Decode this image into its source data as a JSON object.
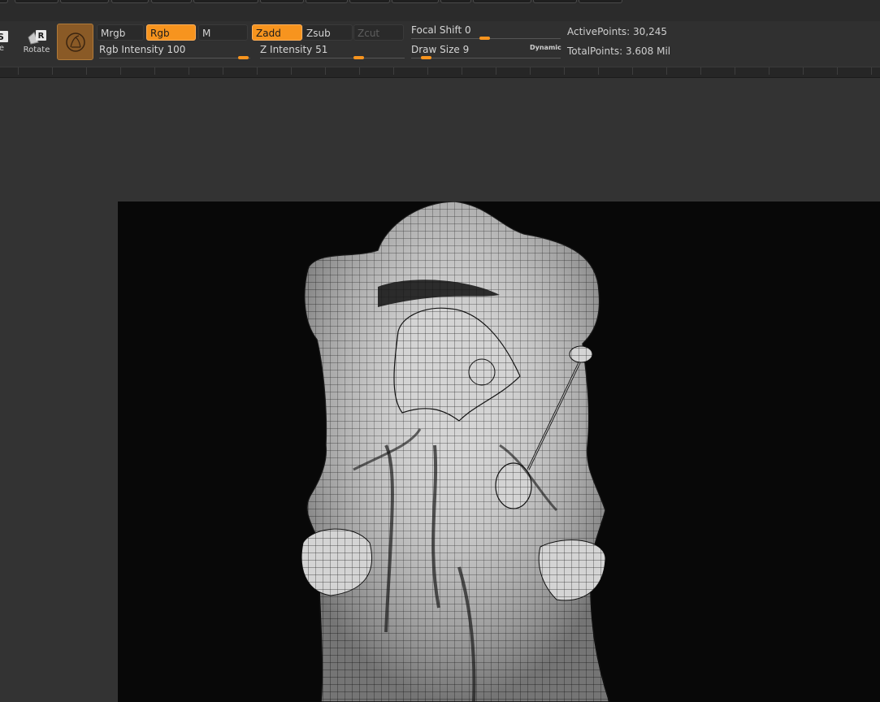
{
  "toolbar": {
    "left_tools": [
      {
        "letter": "S",
        "label": "e",
        "icon": "scale-icon"
      },
      {
        "letter": "R",
        "label": "Rotate",
        "icon": "rotate-icon"
      }
    ],
    "material_icon": "material-sphere-icon",
    "modes": {
      "mrgb": "Mrgb",
      "rgb": "Rgb",
      "m": "M",
      "zadd": "Zadd",
      "zsub": "Zsub",
      "zcut": "Zcut"
    },
    "sliders": {
      "rgb_intensity": {
        "label": "Rgb Intensity",
        "value": "100",
        "fraction": 1.0
      },
      "z_intensity": {
        "label": "Z Intensity",
        "value": "51",
        "fraction": 0.51
      },
      "focal_shift": {
        "label": "Focal Shift",
        "value": "0",
        "fraction": 0.5
      },
      "draw_size": {
        "label": "Draw Size",
        "value": "9",
        "fraction": 0.0
      }
    },
    "dynamic_label": "Dynamic",
    "stats": {
      "active_label": "ActivePoints:",
      "active_value": "30,245",
      "total_label": "TotalPoints:",
      "total_value": "3.608 Mil"
    }
  },
  "colors": {
    "accent": "#f7941e",
    "material": "#8a5a26",
    "background": "#333333",
    "canvas": "#080808"
  }
}
